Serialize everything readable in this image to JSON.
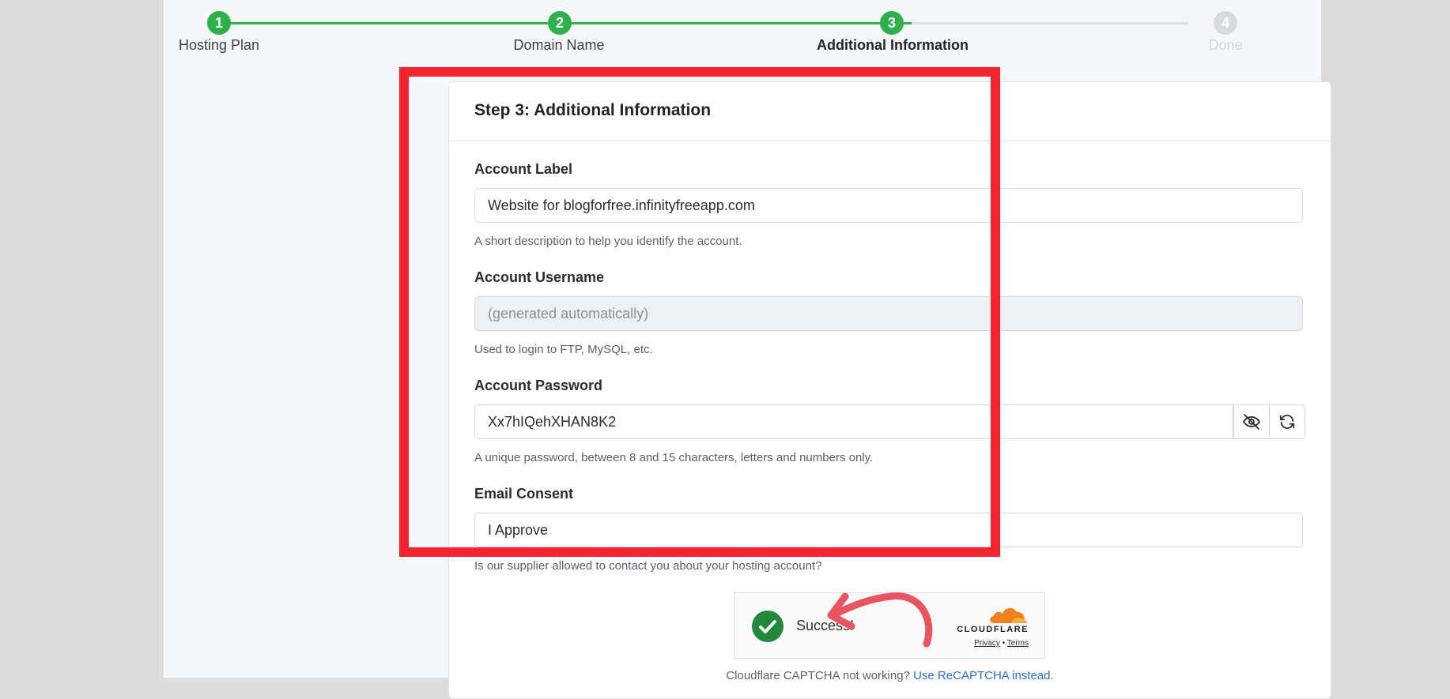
{
  "stepper": {
    "steps": [
      {
        "number": "1",
        "label": "Hosting Plan",
        "state": "done"
      },
      {
        "number": "2",
        "label": "Domain Name",
        "state": "done"
      },
      {
        "number": "3",
        "label": "Additional Information",
        "state": "active"
      },
      {
        "number": "4",
        "label": "Done",
        "state": "todo"
      }
    ]
  },
  "card": {
    "title": "Step 3: Additional Information",
    "account_label": {
      "label": "Account Label",
      "value": "Website for blogforfree.infinityfreeapp.com",
      "help": "A short description to help you identify the account."
    },
    "account_username": {
      "label": "Account Username",
      "placeholder": "(generated automatically)",
      "help": "Used to login to FTP, MySQL, etc."
    },
    "account_password": {
      "label": "Account Password",
      "value": "Xx7hIQehXHAN8K2",
      "help": "A unique password, between 8 and 15 characters, letters and numbers only."
    },
    "email_consent": {
      "label": "Email Consent",
      "value": "I Approve",
      "help": "Is our supplier allowed to contact you about your hosting account?"
    }
  },
  "captcha": {
    "status": "Success!",
    "brand": "CLOUDFLARE",
    "privacy": "Privacy",
    "separator": "•",
    "terms": "Terms",
    "note_prefix": "Cloudflare CAPTCHA not working?",
    "note_link": "Use ReCAPTCHA instead",
    "note_suffix": "."
  },
  "colors": {
    "step_done": "#2eb14a",
    "highlight": "#f5232f",
    "annotation_arrow": "#e8545f"
  }
}
